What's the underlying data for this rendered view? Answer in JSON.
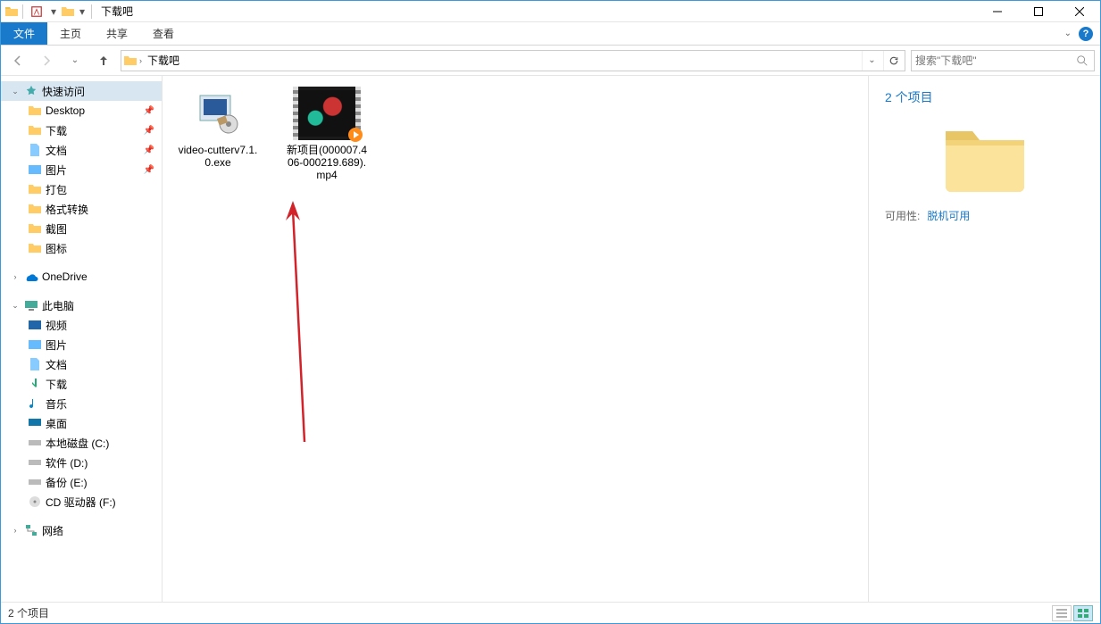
{
  "window": {
    "title": "下载吧"
  },
  "ribbon": {
    "file": "文件",
    "tabs": [
      "主页",
      "共享",
      "查看"
    ]
  },
  "address": {
    "crumbs": [
      "下载吧"
    ],
    "search_placeholder": "搜索\"下载吧\""
  },
  "sidebar": {
    "quick_access": "快速访问",
    "quick_items": [
      {
        "label": "Desktop",
        "pinned": true
      },
      {
        "label": "下载",
        "pinned": true
      },
      {
        "label": "文档",
        "pinned": true
      },
      {
        "label": "图片",
        "pinned": true
      },
      {
        "label": "打包",
        "pinned": false
      },
      {
        "label": "格式转换",
        "pinned": false
      },
      {
        "label": "截图",
        "pinned": false
      },
      {
        "label": "图标",
        "pinned": false
      }
    ],
    "onedrive": "OneDrive",
    "this_pc": "此电脑",
    "pc_items": [
      "视频",
      "图片",
      "文档",
      "下载",
      "音乐",
      "桌面",
      "本地磁盘 (C:)",
      "软件 (D:)",
      "备份 (E:)",
      "CD 驱动器 (F:)"
    ],
    "network": "网络"
  },
  "items": [
    {
      "name": "video-cutterv7.1.0.exe",
      "kind": "exe"
    },
    {
      "name": "新项目(000007.406-000219.689).mp4",
      "kind": "video"
    }
  ],
  "details": {
    "heading": "2 个项目",
    "availability_label": "可用性:",
    "availability_value": "脱机可用"
  },
  "status": {
    "text": "2 个项目"
  }
}
